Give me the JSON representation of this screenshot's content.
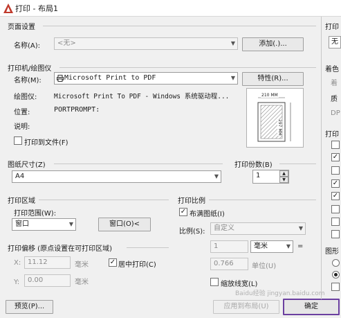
{
  "window": {
    "title": "打印 - 布局1"
  },
  "page_setup": {
    "section": "页面设置",
    "name_label": "名称(A):",
    "name_value": "<无>",
    "add_button": "添加(.)..."
  },
  "printer": {
    "section": "打印机/绘图仪",
    "name_label": "名称(M):",
    "name_value": "Microsoft Print to PDF",
    "properties_button": "特性(R)...",
    "plotter_label": "绘图仪:",
    "plotter_value": "Microsoft Print To PDF - Windows 系统驱动程...",
    "location_label": "位置:",
    "location_value": "PORTPROMPT:",
    "description_label": "说明:",
    "print_to_file": "打印到文件(F)",
    "preview_width": "210 MM",
    "preview_height": "297 MM"
  },
  "paper_size": {
    "section": "图纸尺寸(Z)",
    "value": "A4"
  },
  "copies": {
    "section": "打印份数(B)",
    "value": "1"
  },
  "plot_area": {
    "section": "打印区域",
    "range_label": "打印范围(W):",
    "range_value": "窗口",
    "window_button": "窗口(O)<"
  },
  "plot_scale": {
    "section": "打印比例",
    "fit_paper": "布满图纸(I)",
    "fit_paper_checked": true,
    "scale_label": "比例(S):",
    "scale_value": "自定义",
    "value1": "1",
    "unit": "毫米",
    "equals": "=",
    "value2": "0.766",
    "unit_label": "单位(U)",
    "scale_lineweights": "缩放线宽(L)"
  },
  "plot_offset": {
    "section": "打印偏移 (原点设置在可打印区域)",
    "x_label": "X:",
    "x_value": "11.12",
    "x_unit": "毫米",
    "y_label": "Y:",
    "y_value": "0.00",
    "y_unit": "毫米",
    "center_plot": "居中打印(C)",
    "center_plot_checked": true
  },
  "footer": {
    "preview_button": "预览(P)...",
    "apply_button": "应用到布局(U)",
    "ok_button": "确定",
    "watermark": "Baidu经验 jingyan.baidu.com"
  },
  "right_panel": {
    "label1": "打印",
    "value1": "无",
    "label2": "着色",
    "label3": "着",
    "label4": "质",
    "label5": "DP",
    "label6": "打印",
    "label7": "图形"
  },
  "colors": {
    "accent": "#6b3fa0",
    "autocad_red": "#c0392b"
  }
}
